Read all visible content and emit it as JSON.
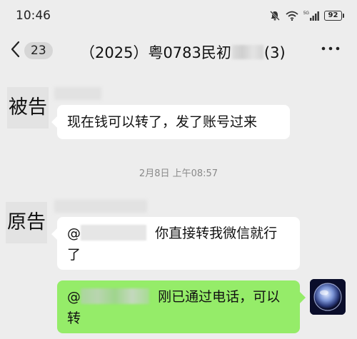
{
  "status_bar": {
    "time": "10:46",
    "battery": "92",
    "icons": [
      "mute-icon",
      "wifi-icon",
      "signal-5g-icon",
      "battery-icon"
    ]
  },
  "header": {
    "back_icon": "chevron-left-icon",
    "unread_count": "23",
    "title_prefix": "（2025）粤0783民初",
    "title_suffix": "(3)",
    "more_icon": "more-dots-icon"
  },
  "messages": [
    {
      "sender": "被告",
      "side": "left",
      "text": "现在钱可以转了，发了账号过来"
    },
    {
      "type": "timestamp",
      "text": "2月8日 上午08:57"
    },
    {
      "sender": "原告",
      "side": "left",
      "mention": "@",
      "text": "你直接转我微信就行了"
    },
    {
      "sender": "self",
      "side": "right",
      "mention": "@",
      "text": "刚已通过电话，可以转"
    }
  ],
  "colors": {
    "background": "#ededed",
    "bubble_incoming": "#ffffff",
    "bubble_outgoing": "#95ec69",
    "timestamp": "#8a8a8a"
  }
}
